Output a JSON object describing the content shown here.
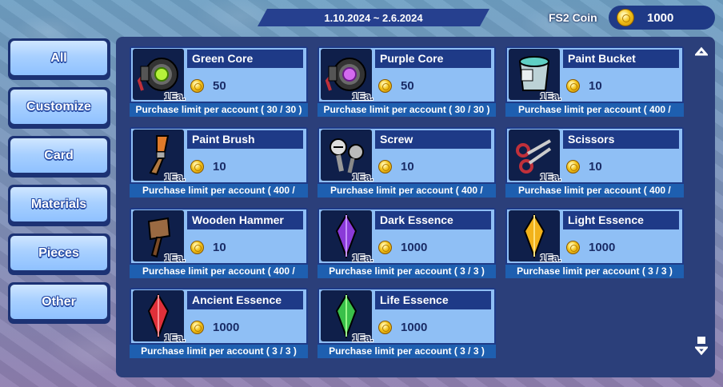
{
  "header": {
    "date_range": "1.10.2024 ~ 2.6.2024",
    "coin_label": "FS2 Coin",
    "coin_amount": "1000"
  },
  "sidebar": {
    "items": [
      {
        "label": "All"
      },
      {
        "label": "Customize"
      },
      {
        "label": "Card"
      },
      {
        "label": "Materials"
      },
      {
        "label": "Pieces"
      },
      {
        "label": "Other"
      }
    ]
  },
  "items": [
    {
      "name": "Green Core",
      "qty": "1Ea.",
      "price": "50",
      "limit": "Purchase limit per account ( 30 / 30 )",
      "icon": "green-core-icon"
    },
    {
      "name": "Purple Core",
      "qty": "1Ea.",
      "price": "50",
      "limit": "Purchase limit per account ( 30 / 30 )",
      "icon": "purple-core-icon"
    },
    {
      "name": "Paint Bucket",
      "qty": "1Ea.",
      "price": "10",
      "limit": "Purchase limit per account ( 400 /",
      "icon": "paint-bucket-icon"
    },
    {
      "name": "Paint Brush",
      "qty": "1Ea.",
      "price": "10",
      "limit": "Purchase limit per account ( 400 /",
      "icon": "paint-brush-icon"
    },
    {
      "name": "Screw",
      "qty": "1Ea.",
      "price": "10",
      "limit": "Purchase limit per account ( 400 /",
      "icon": "screw-icon"
    },
    {
      "name": "Scissors",
      "qty": "1Ea.",
      "price": "10",
      "limit": "Purchase limit per account ( 400 /",
      "icon": "scissors-icon"
    },
    {
      "name": "Wooden Hammer",
      "qty": "1Ea.",
      "price": "10",
      "limit": "Purchase limit per account ( 400 /",
      "icon": "wooden-hammer-icon"
    },
    {
      "name": "Dark Essence",
      "qty": "1Ea.",
      "price": "1000",
      "limit": "Purchase limit per account ( 3 / 3 )",
      "icon": "dark-essence-icon"
    },
    {
      "name": "Light Essence",
      "qty": "1Ea.",
      "price": "1000",
      "limit": "Purchase limit per account ( 3 / 3 )",
      "icon": "light-essence-icon"
    },
    {
      "name": "Ancient Essence",
      "qty": "1Ea.",
      "price": "1000",
      "limit": "Purchase limit per account ( 3 / 3 )",
      "icon": "ancient-essence-icon"
    },
    {
      "name": "Life Essence",
      "qty": "1Ea.",
      "price": "1000",
      "limit": "Purchase limit per account ( 3 / 3 )",
      "icon": "life-essence-icon"
    }
  ],
  "colors": {
    "panel": "#2b3f7a",
    "card_body": "#8fbff5",
    "card_header": "#1e3a87",
    "limit_bar": "#1e5fb0",
    "coin": "#f2c21a"
  }
}
